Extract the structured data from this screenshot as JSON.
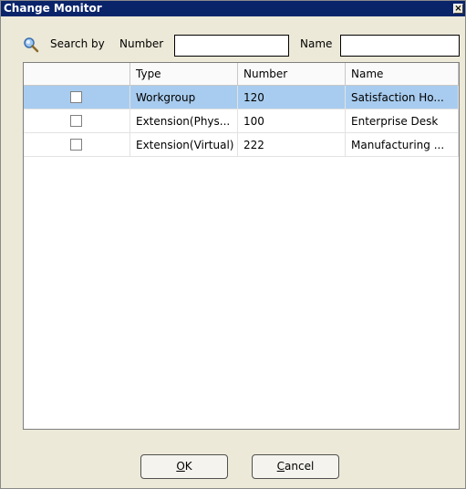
{
  "window": {
    "title": "Change Monitor",
    "close_glyph": "×"
  },
  "search": {
    "label": "Search by",
    "number_label": "Number",
    "number_value": "",
    "name_label": "Name",
    "name_value": ""
  },
  "grid": {
    "columns": [
      "",
      "Type",
      "Number",
      "Name"
    ],
    "rows": [
      {
        "checked": false,
        "type": "Workgroup",
        "number": "120",
        "name": "Satisfaction Ho...",
        "selected": true
      },
      {
        "checked": false,
        "type": "Extension(Phys...",
        "number": "100",
        "name": "Enterprise Desk",
        "selected": false
      },
      {
        "checked": false,
        "type": "Extension(Virtual)",
        "number": "222",
        "name": "Manufacturing ...",
        "selected": false
      }
    ]
  },
  "buttons": {
    "ok_mnemonic": "O",
    "ok_rest": "K",
    "cancel_mnemonic": "C",
    "cancel_rest": "ancel"
  },
  "colors": {
    "titlebar": "#0a246a",
    "selection": "#a8ccef",
    "dialog_bg": "#ece9d8"
  },
  "icons": {
    "search": "magnifier-icon"
  }
}
